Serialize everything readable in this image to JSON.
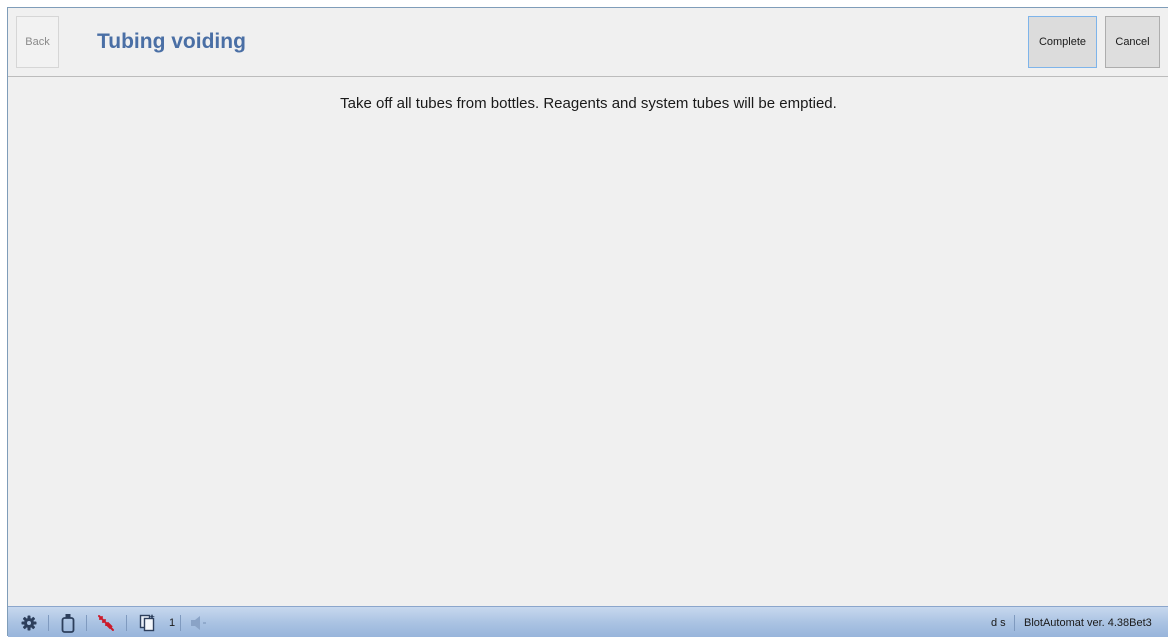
{
  "header": {
    "back_label": "Back",
    "title": "Tubing voiding",
    "complete_label": "Complete",
    "cancel_label": "Cancel"
  },
  "main": {
    "instruction": "Take off all tubes from bottles. Reagents and system tubes will be emptied."
  },
  "statusbar": {
    "icons": [
      "gear-icon",
      "bottle-icon",
      "syringe-icon",
      "documents-icon",
      "speaker-icon"
    ],
    "documents_count": "1",
    "status_text": "d s",
    "version": "BlotAutomat ver. 4.38Bet3"
  },
  "colors": {
    "title": "#4a6fa5",
    "statusbar": "#a9c2e2",
    "syringe": "#cc1a2a"
  }
}
